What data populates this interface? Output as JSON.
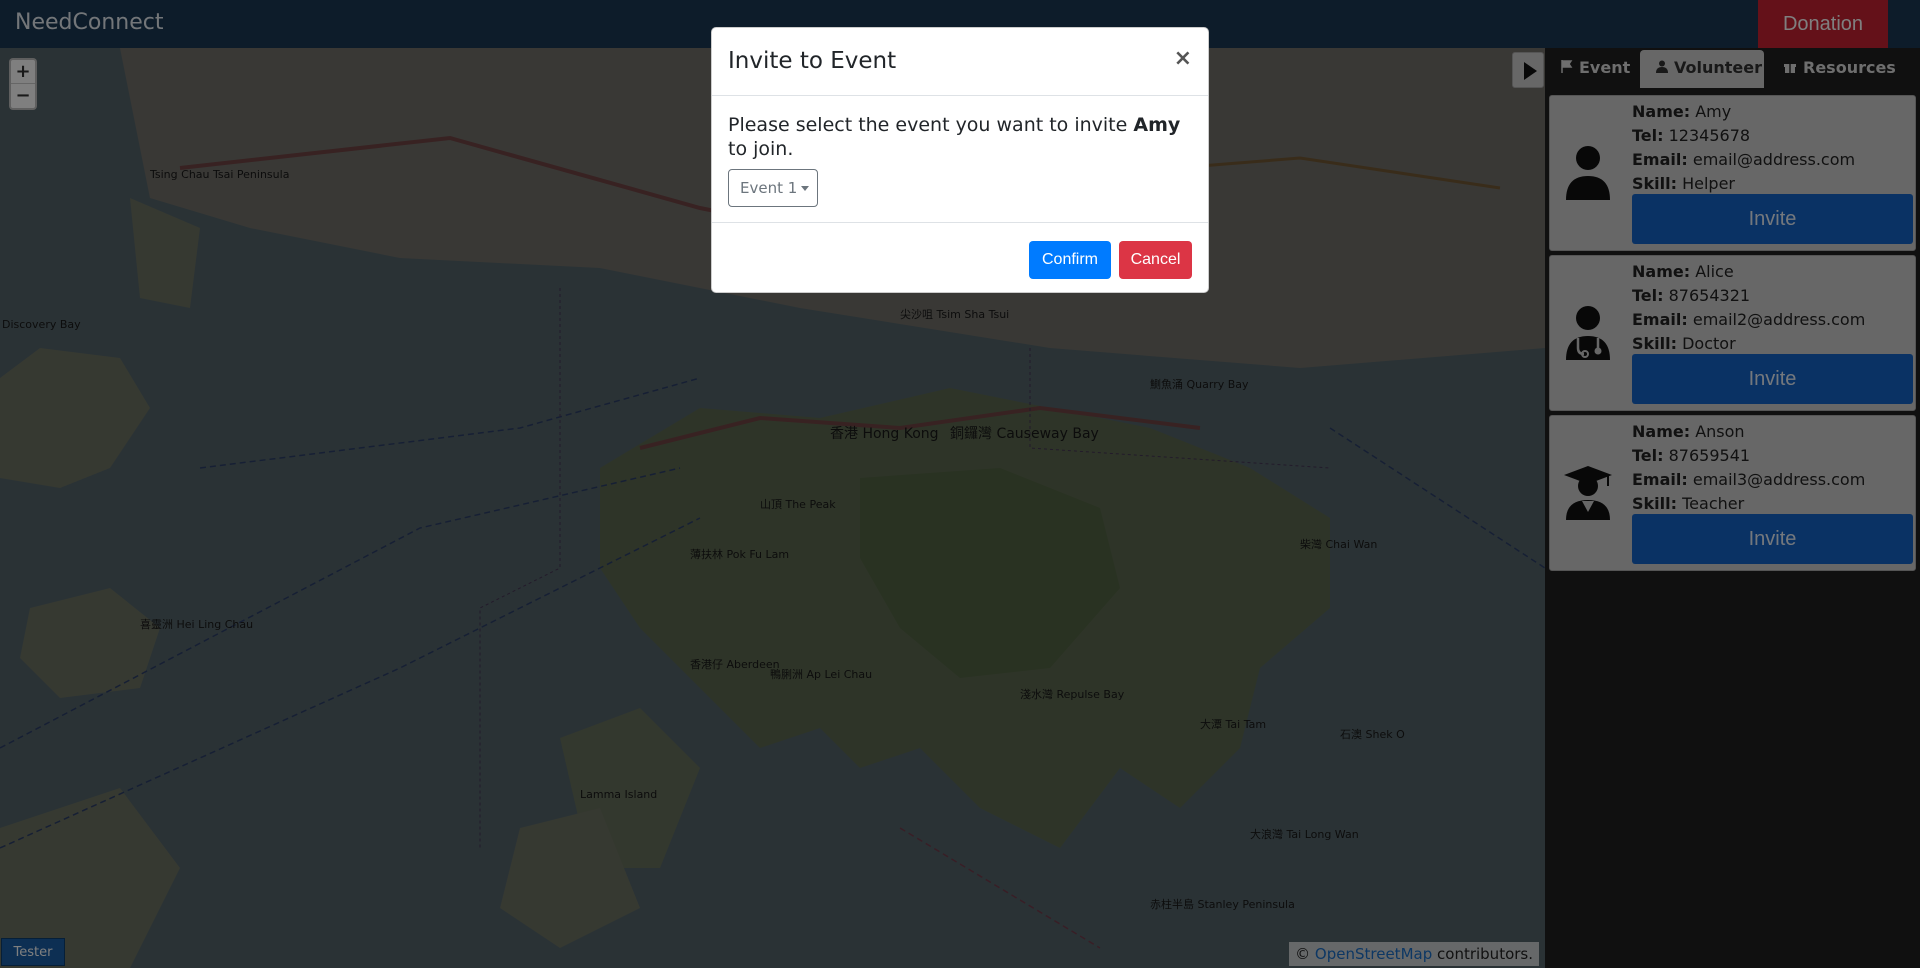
{
  "navbar": {
    "brand": "NeedConnect",
    "donation": "Donation"
  },
  "map": {
    "zoom_in": "+",
    "zoom_out": "−",
    "tester": "Tester",
    "attribution": {
      "prefix": "©",
      "link": "OpenStreetMap",
      "suffix": "contributors."
    },
    "labels": [
      "Tsing Chau Tsai Peninsula",
      "Discovery Bay",
      "香港 Hong Kong",
      "銅鑼灣 Causeway Bay",
      "山頂 The Peak",
      "薄扶林 Pok Fu Lam",
      "香港仔 Aberdeen",
      "淺水灣 Repulse Bay",
      "赤柱半島 Stanley Peninsula",
      "大潭 Tai Tam",
      "柴灣 Chai Wan",
      "鰂魚涌 Quarry Bay",
      "尖沙咀 Tsim Sha Tsui",
      "鴨脷洲 Ap Lei Chau",
      "喜靈洲 Hei Ling Chau",
      "Lamma Island",
      "石澳 Shek O",
      "大浪灣 Tai Long Wan"
    ]
  },
  "sidebar": {
    "tabs": [
      {
        "icon": "flag-icon",
        "label": "Event"
      },
      {
        "icon": "user-icon",
        "label": "Volunteer"
      },
      {
        "icon": "gift-icon",
        "label": "Resources"
      }
    ],
    "field_labels": {
      "name": "Name:",
      "tel": "Tel:",
      "email": "Email:",
      "skill": "Skill:"
    },
    "volunteers": [
      {
        "name": "Amy",
        "tel": "12345678",
        "email": "email@address.com",
        "skill": "Helper",
        "invite": "Invite",
        "avatar": "user-icon"
      },
      {
        "name": "Alice",
        "tel": "87654321",
        "email": "email2@address.com",
        "skill": "Doctor",
        "invite": "Invite",
        "avatar": "doctor-icon"
      },
      {
        "name": "Anson",
        "tel": "87659541",
        "email": "email3@address.com",
        "skill": "Teacher",
        "invite": "Invite",
        "avatar": "graduate-icon"
      }
    ]
  },
  "modal": {
    "title": "Invite to Event",
    "close": "×",
    "body_prefix": "Please select the event you want to invite",
    "body_name": "Amy",
    "body_suffix": "to join.",
    "dropdown": "Event 1",
    "confirm": "Confirm",
    "cancel": "Cancel"
  },
  "colors": {
    "navbar": "#1b3954",
    "donation": "#c82333",
    "invite": "#1565c8",
    "confirm": "#007bff",
    "cancel": "#dc3545"
  }
}
